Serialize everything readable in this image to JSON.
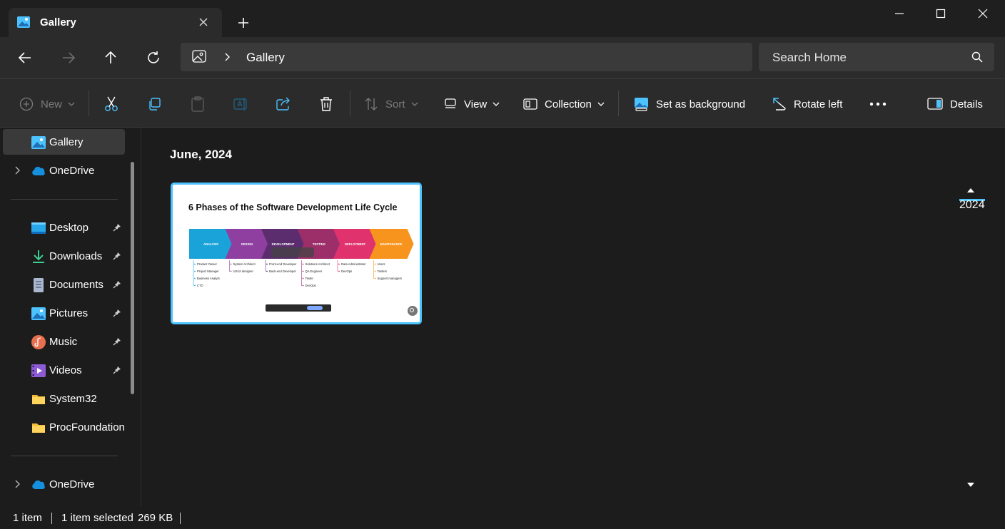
{
  "window": {
    "tab_title": "Gallery"
  },
  "address": {
    "path": "Gallery",
    "search_placeholder": "Search Home"
  },
  "toolbar": {
    "new_label": "New",
    "sort_label": "Sort",
    "view_label": "View",
    "collection_label": "Collection",
    "set_background_label": "Set as background",
    "rotate_left_label": "Rotate left",
    "details_label": "Details"
  },
  "sidebar": {
    "items": [
      {
        "label": "Gallery",
        "icon": "gallery-icon",
        "selected": true
      },
      {
        "label": "OneDrive",
        "icon": "onedrive-icon",
        "expandable": true
      },
      {
        "label": "Desktop",
        "icon": "desktop-icon",
        "pinned": true
      },
      {
        "label": "Downloads",
        "icon": "downloads-icon",
        "pinned": true
      },
      {
        "label": "Documents",
        "icon": "documents-icon",
        "pinned": true
      },
      {
        "label": "Pictures",
        "icon": "pictures-icon",
        "pinned": true
      },
      {
        "label": "Music",
        "icon": "music-icon",
        "pinned": true
      },
      {
        "label": "Videos",
        "icon": "videos-icon",
        "pinned": true
      },
      {
        "label": "System32",
        "icon": "folder-icon"
      },
      {
        "label": "ProcFoundation",
        "icon": "folder-icon"
      },
      {
        "label": "OneDrive",
        "icon": "onedrive-icon",
        "expandable": true
      }
    ]
  },
  "main": {
    "group_title": "June, 2024",
    "timeline_year": "2024",
    "thumbnail": {
      "title": "6 Phases of the Software Development Life Cycle",
      "phases": [
        "ANALYSIS",
        "DESIGN",
        "DEVELOPMENT",
        "TESTING",
        "DEPLOYMENT",
        "MAINTENANCE"
      ],
      "phase_colors": [
        "#1aa3d9",
        "#8e3fa0",
        "#5c2d6e",
        "#9c2f6a",
        "#e0336e",
        "#f7941d"
      ],
      "roles": [
        [
          "Product Owner",
          "Project Manager",
          "Business Analyst",
          "CTO"
        ],
        [
          "System Architect",
          "UX/UI designer"
        ],
        [
          "Front-end Developer",
          "Back-end Developer"
        ],
        [
          "Solutions Architect",
          "QA Engineer",
          "Tester",
          "DevOps"
        ],
        [
          "Data Administrator",
          "DevOps"
        ],
        [
          "Users",
          "Testers",
          "Support managers"
        ]
      ]
    }
  },
  "status": {
    "item_count": "1 item",
    "selection": "1 item selected",
    "size": "269 KB"
  },
  "colors": {
    "accent": "#4cc2ff",
    "background": "#1c1c1c",
    "chrome": "#2b2b2b"
  }
}
